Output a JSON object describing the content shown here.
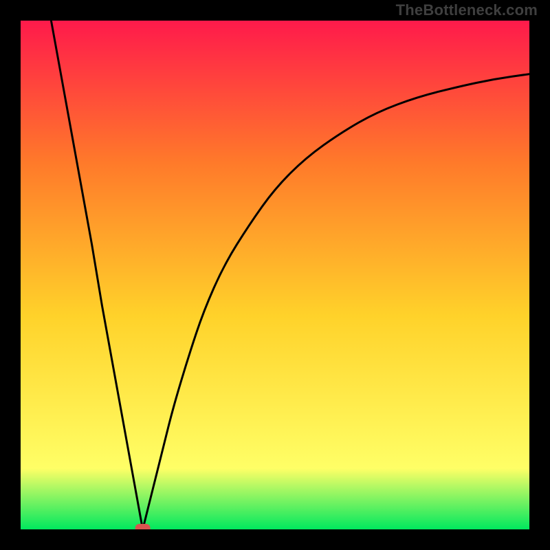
{
  "watermark": "TheBottleneck.com",
  "chart_data": {
    "type": "line",
    "title": "",
    "xlabel": "",
    "ylabel": "",
    "x_range": [
      0,
      100
    ],
    "y_range": [
      0,
      100
    ],
    "grid": false,
    "legend": false,
    "background_gradient": {
      "top_color": "#ff1a4b",
      "upper_mid_color": "#ff7a2a",
      "mid_color": "#ffd22a",
      "lower_mid_color": "#ffff66",
      "bottom_color": "#00e85e"
    },
    "curve": {
      "description": "V-shaped bottleneck curve: steep linear fall from top-left to a minimum, then asymptotic rise toward upper right",
      "minimum_x": 24,
      "minimum_y": 0,
      "points": [
        {
          "x": 6,
          "y": 100
        },
        {
          "x": 8,
          "y": 89
        },
        {
          "x": 10,
          "y": 78
        },
        {
          "x": 12,
          "y": 67
        },
        {
          "x": 14,
          "y": 56
        },
        {
          "x": 16,
          "y": 44
        },
        {
          "x": 18,
          "y": 33
        },
        {
          "x": 20,
          "y": 22
        },
        {
          "x": 22,
          "y": 11
        },
        {
          "x": 24,
          "y": 0
        },
        {
          "x": 26,
          "y": 8
        },
        {
          "x": 28,
          "y": 16
        },
        {
          "x": 30,
          "y": 24
        },
        {
          "x": 33,
          "y": 34
        },
        {
          "x": 36,
          "y": 43
        },
        {
          "x": 40,
          "y": 52
        },
        {
          "x": 45,
          "y": 60
        },
        {
          "x": 50,
          "y": 67
        },
        {
          "x": 56,
          "y": 73
        },
        {
          "x": 63,
          "y": 78
        },
        {
          "x": 70,
          "y": 82
        },
        {
          "x": 78,
          "y": 85
        },
        {
          "x": 86,
          "y": 87
        },
        {
          "x": 93,
          "y": 88.5
        },
        {
          "x": 100,
          "y": 89.5
        }
      ]
    },
    "marker": {
      "description": "small red rounded marker at the curve minimum",
      "x": 24,
      "y": 0,
      "color": "#d9544f"
    }
  }
}
